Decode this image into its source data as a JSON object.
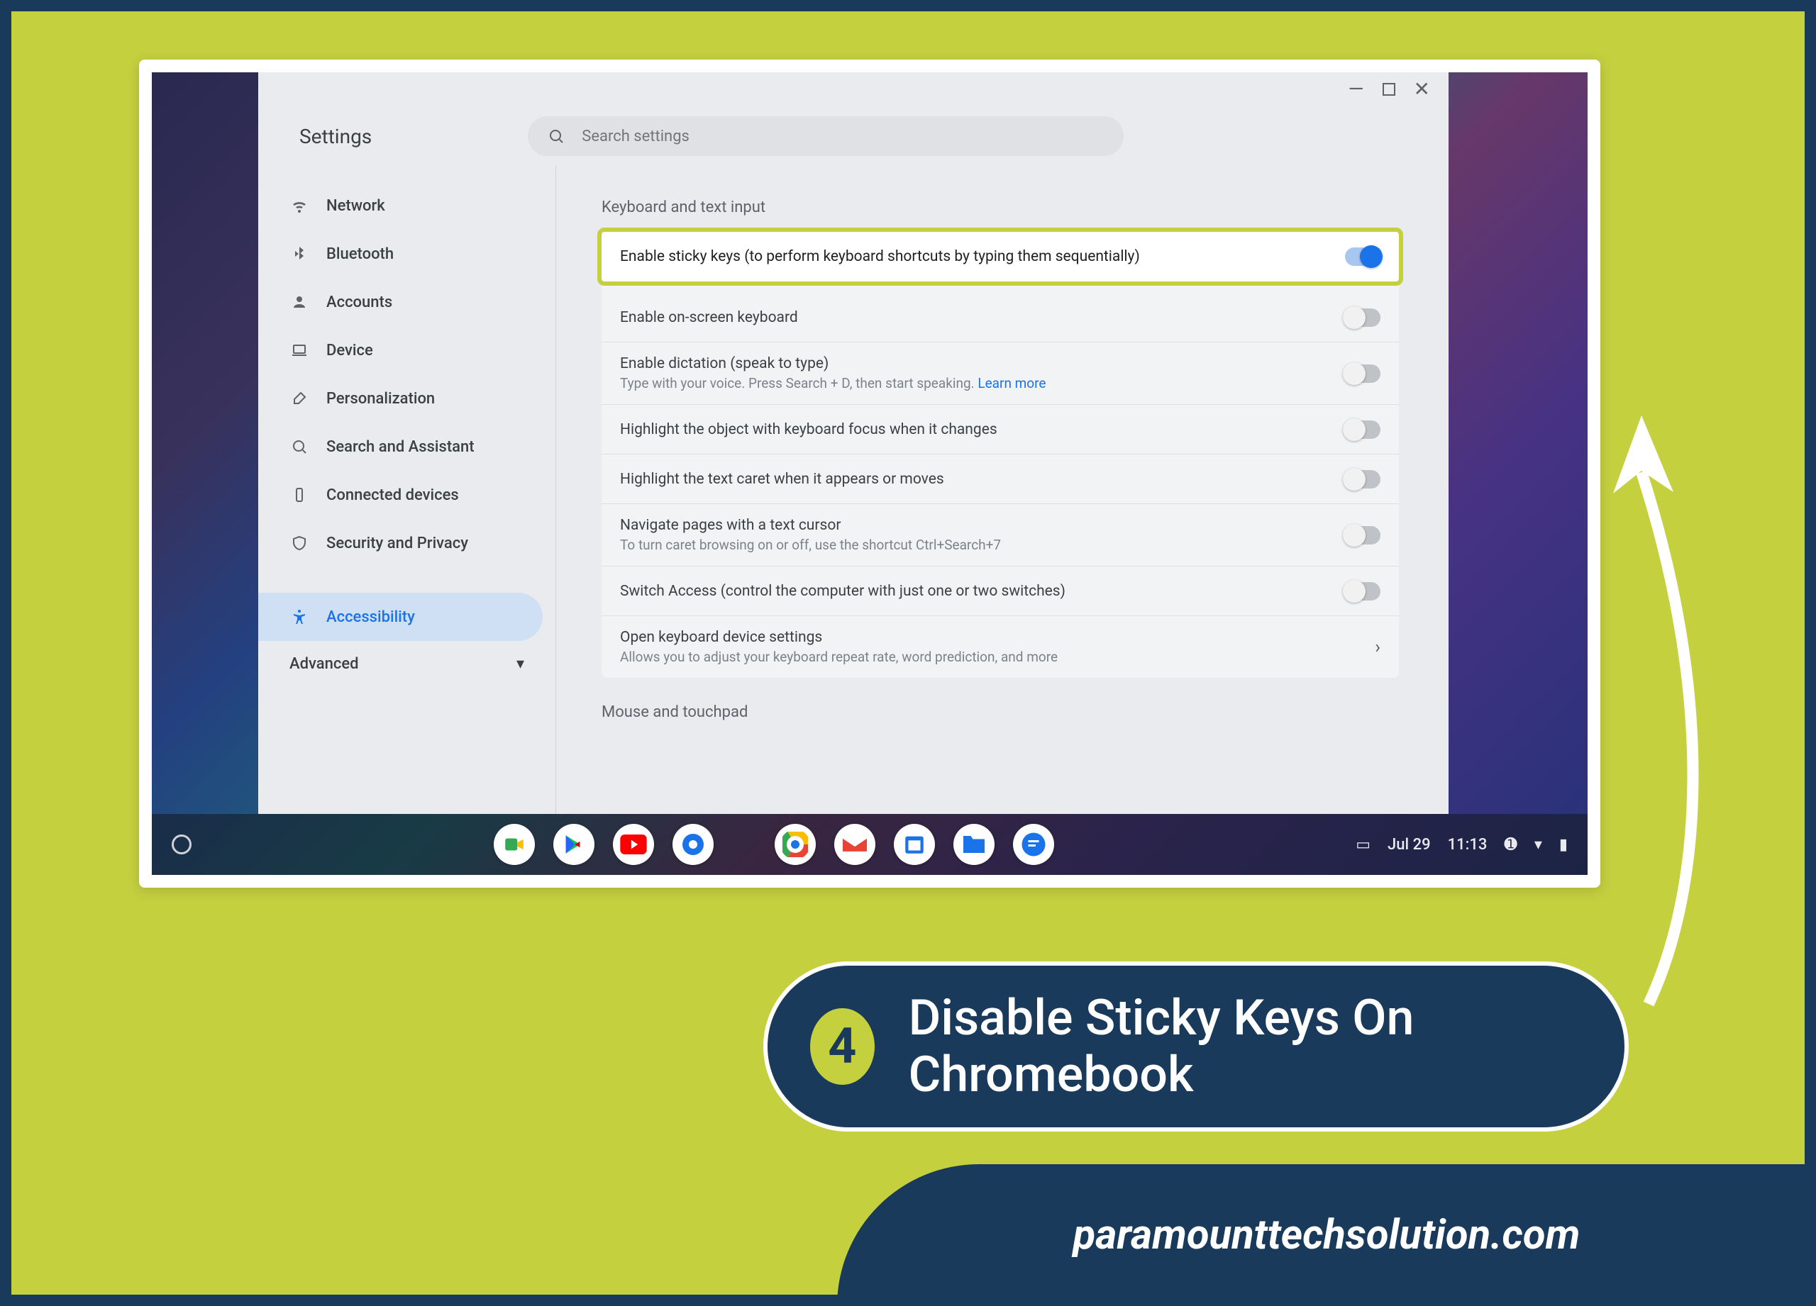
{
  "header": {
    "title": "Settings"
  },
  "search": {
    "placeholder": "Search settings"
  },
  "sidebar": {
    "items": [
      {
        "label": "Network"
      },
      {
        "label": "Bluetooth"
      },
      {
        "label": "Accounts"
      },
      {
        "label": "Device"
      },
      {
        "label": "Personalization"
      },
      {
        "label": "Search and Assistant"
      },
      {
        "label": "Connected devices"
      },
      {
        "label": "Security and Privacy"
      },
      {
        "label": "Accessibility"
      }
    ],
    "advanced_label": "Advanced"
  },
  "main": {
    "section_title": "Keyboard and text input",
    "rows": {
      "sticky": {
        "label": "Enable sticky keys (to perform keyboard shortcuts by typing them sequentially)"
      },
      "osk": {
        "label": "Enable on-screen keyboard"
      },
      "dict": {
        "label": "Enable dictation (speak to type)",
        "sub": "Type with your voice. Press Search + D, then start speaking. ",
        "learn": "Learn more"
      },
      "focus": {
        "label": "Highlight the object with keyboard focus when it changes"
      },
      "caret": {
        "label": "Highlight the text caret when it appears or moves"
      },
      "textcursor": {
        "label": "Navigate pages with a text cursor",
        "sub": "To turn caret browsing on or off, use the shortcut Ctrl+Search+7"
      },
      "switch": {
        "label": "Switch Access (control the computer with just one or two switches)"
      },
      "kbsettings": {
        "label": "Open keyboard device settings",
        "sub": "Allows you to adjust your keyboard repeat rate, word prediction, and more"
      }
    },
    "mouse_title": "Mouse and touchpad"
  },
  "shelf": {
    "date": "Jul 29",
    "time": "11:13"
  },
  "caption": {
    "num": "4",
    "text": "Disable Sticky Keys On Chromebook"
  },
  "brand": "paramounttechsolution.com"
}
